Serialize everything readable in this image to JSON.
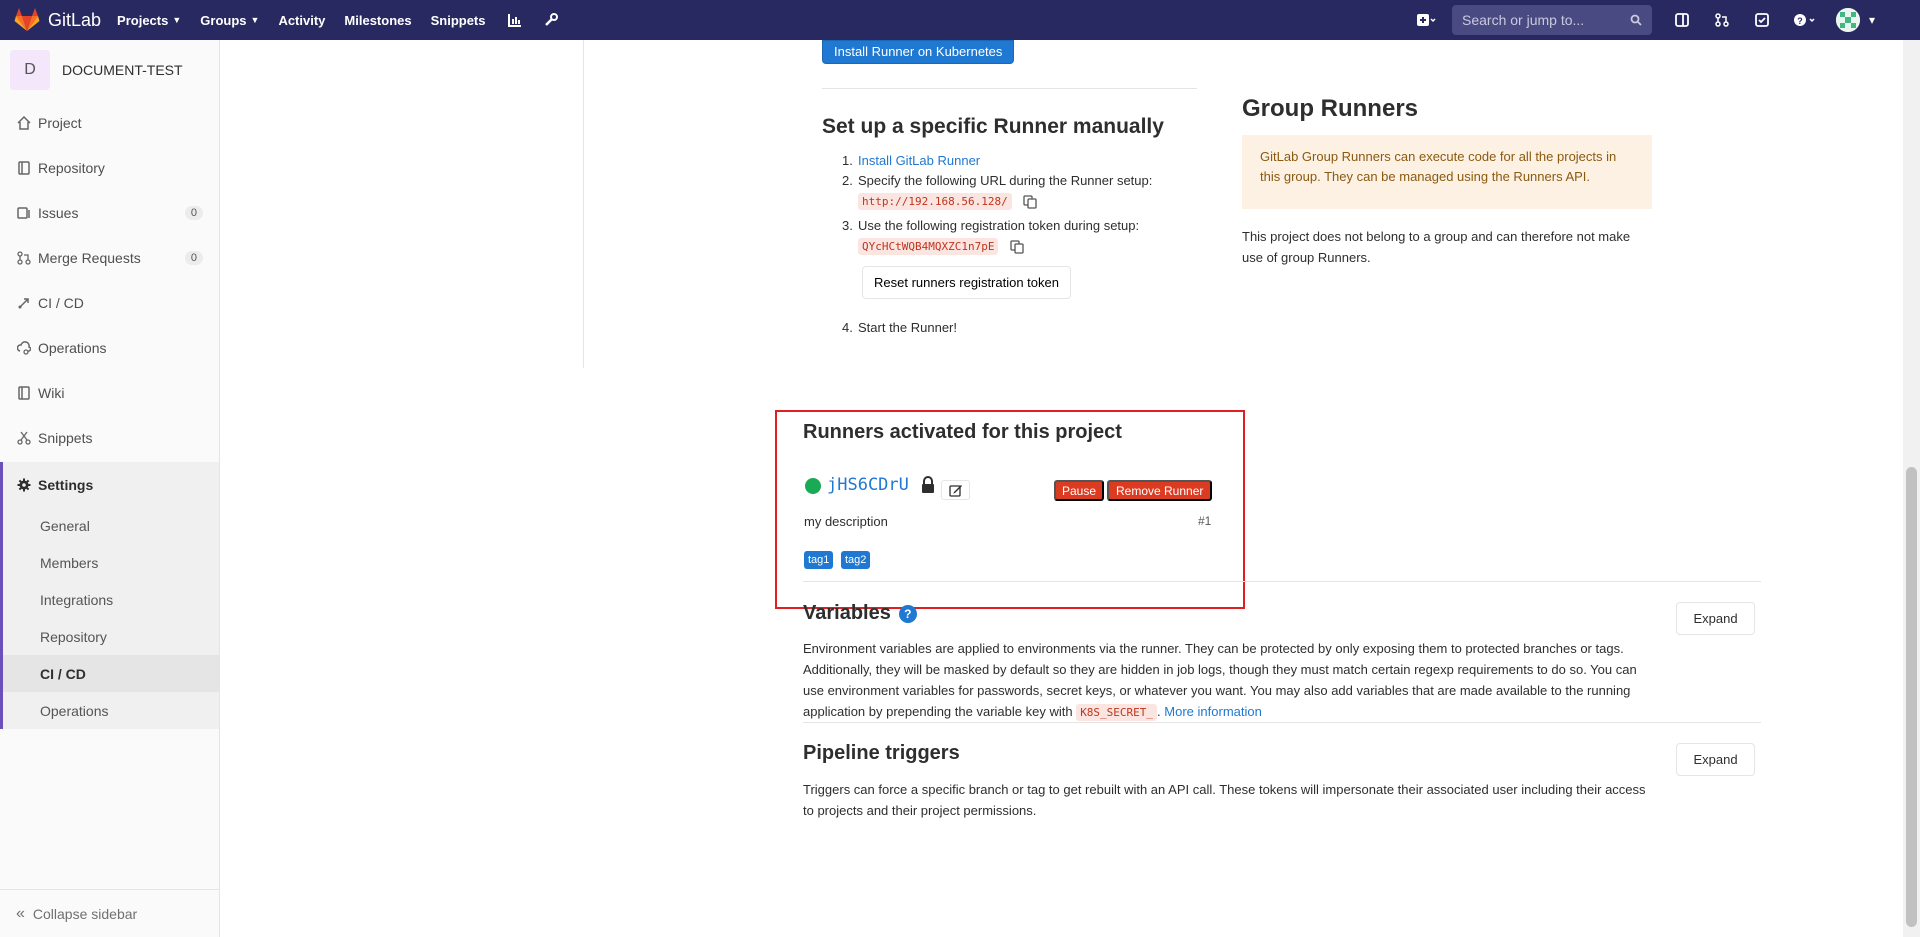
{
  "navbar": {
    "brand": "GitLab",
    "links": [
      {
        "label": "Projects",
        "has_caret": true
      },
      {
        "label": "Groups",
        "has_caret": true
      },
      {
        "label": "Activity",
        "has_caret": false
      },
      {
        "label": "Milestones",
        "has_caret": false
      },
      {
        "label": "Snippets",
        "has_caret": false
      }
    ],
    "search_placeholder": "Search or jump to...",
    "colors": {
      "bg": "#292961"
    }
  },
  "sidebar": {
    "project_initial": "D",
    "project_name": "DOCUMENT-TEST",
    "items": [
      {
        "label": "Project",
        "icon": "home-icon"
      },
      {
        "label": "Repository",
        "icon": "book-icon"
      },
      {
        "label": "Issues",
        "icon": "issues-icon",
        "count": "0"
      },
      {
        "label": "Merge Requests",
        "icon": "merge-request-icon",
        "count": "0"
      },
      {
        "label": "CI / CD",
        "icon": "rocket-icon"
      },
      {
        "label": "Operations",
        "icon": "cloud-gear-icon"
      },
      {
        "label": "Wiki",
        "icon": "book-icon"
      },
      {
        "label": "Snippets",
        "icon": "scissors-icon"
      }
    ],
    "settings": {
      "label": "Settings",
      "subitems": [
        "General",
        "Members",
        "Integrations",
        "Repository",
        "CI / CD",
        "Operations"
      ],
      "active": "CI / CD"
    },
    "collapse_label": "Collapse sidebar"
  },
  "specific_runner": {
    "k8s_button": "Install Runner on Kubernetes",
    "title": "Set up a specific Runner manually",
    "step1_link": "Install GitLab Runner",
    "step2_text": "Specify the following URL during the Runner setup:",
    "url": "http://192.168.56.128/",
    "step3_text": "Use the following registration token during setup:",
    "token": "QYcHCtWQB4MQXZC1n7pE",
    "reset_button": "Reset runners registration token",
    "step4_text": "Start the Runner!"
  },
  "group_runners": {
    "title": "Group Runners",
    "warning": "GitLab Group Runners can execute code for all the projects in this group. They can be managed using the Runners API.",
    "note": "This project does not belong to a group and can therefore not make use of group Runners."
  },
  "activated_runners": {
    "title": "Runners activated for this project",
    "runner_id": "jHS6CDrU",
    "pause_label": "Pause",
    "remove_label": "Remove Runner",
    "description": "my description",
    "number": "#1",
    "tags": [
      "tag1",
      "tag2"
    ],
    "status_color": "#1aaa55"
  },
  "variables": {
    "title": "Variables",
    "text_before": "Environment variables are applied to environments via the runner. They can be protected by only exposing them to protected branches or tags. Additionally, they will be masked by default so they are hidden in job logs, though they must match certain regexp requirements to do so. You can use environment variables for passwords, secret keys, or whatever you want. You may also add variables that are made available to the running application by prepending the variable key with",
    "key_prefix": "K8S_SECRET_",
    "text_after": ".",
    "more_link": "More information",
    "expand_label": "Expand"
  },
  "triggers": {
    "title": "Pipeline triggers",
    "text": "Triggers can force a specific branch or tag to get rebuilt with an API call. These tokens will impersonate their associated user including their access to projects and their project permissions.",
    "expand_label": "Expand"
  }
}
